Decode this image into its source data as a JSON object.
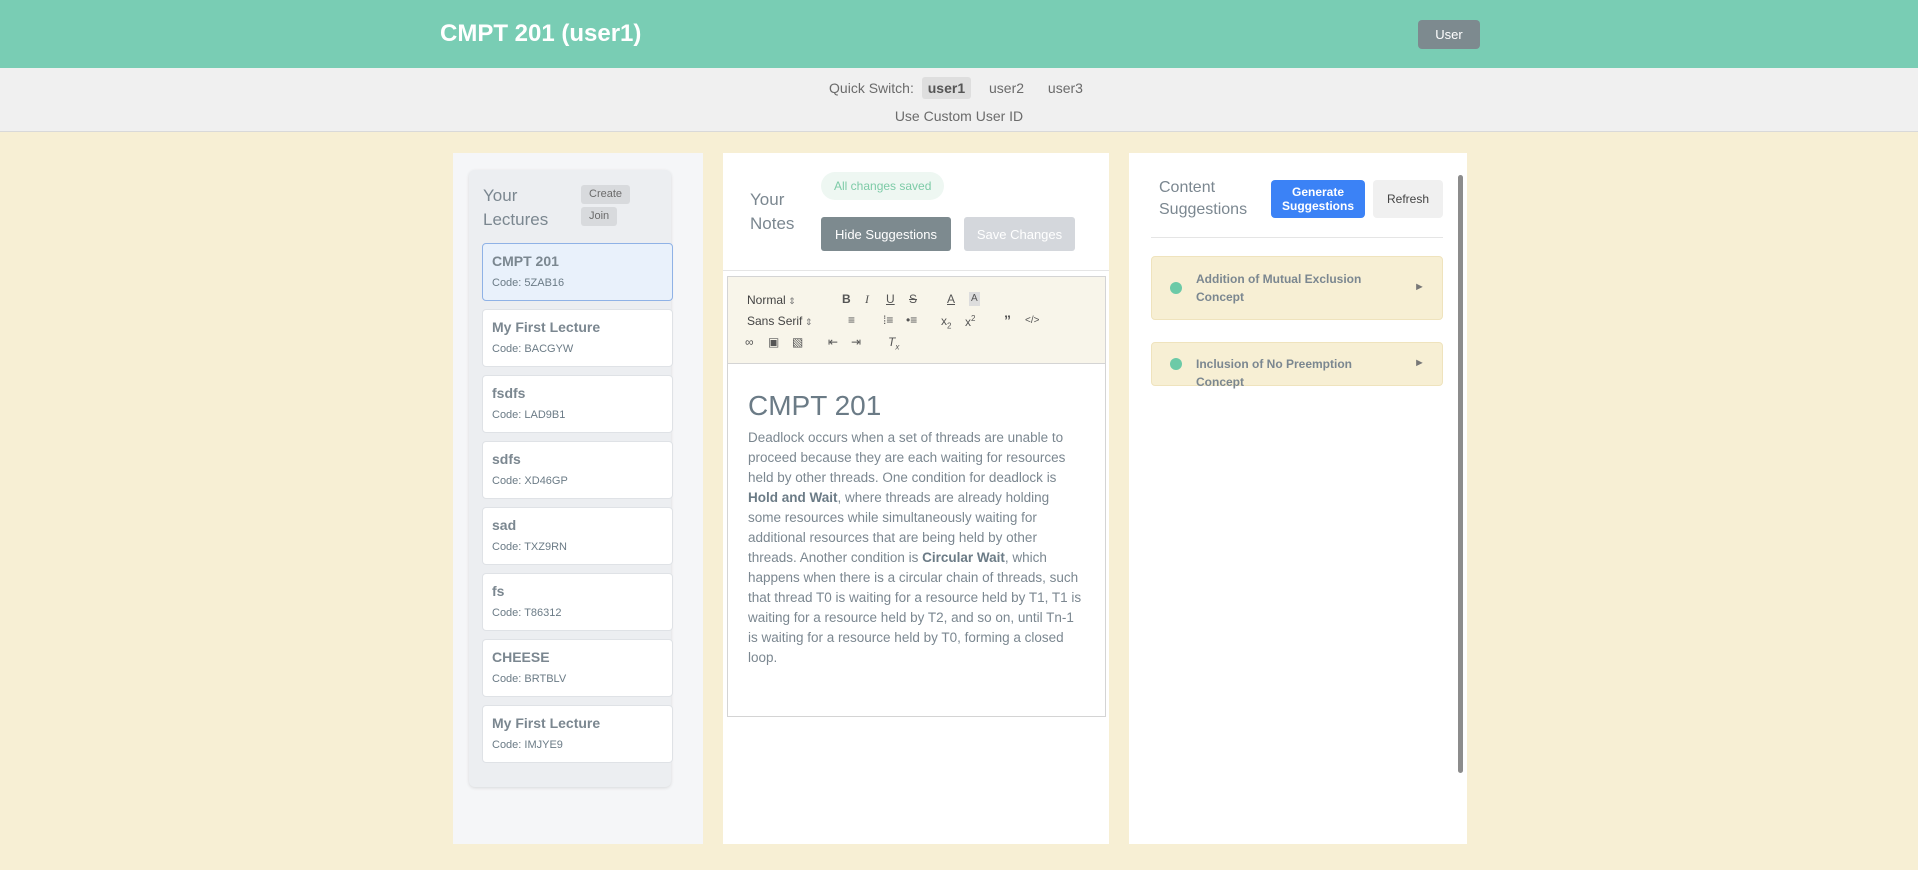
{
  "header": {
    "title": "CMPT 201 (user1)",
    "user_button": "User"
  },
  "quick_switch": {
    "label": "Quick Switch:",
    "users": [
      "user1",
      "user2",
      "user3"
    ],
    "active_user": "user1",
    "custom_id_label": "Use Custom User ID"
  },
  "lectures": {
    "heading": "Your Lectures",
    "create_label": "Create",
    "join_label": "Join",
    "items": [
      {
        "name": "CMPT 201",
        "code": "Code: 5ZAB16",
        "selected": true
      },
      {
        "name": "My First Lecture",
        "code": "Code: BACGYW",
        "selected": false
      },
      {
        "name": "fsdfs",
        "code": "Code: LAD9B1",
        "selected": false
      },
      {
        "name": "sdfs",
        "code": "Code: XD46GP",
        "selected": false
      },
      {
        "name": "sad",
        "code": "Code: TXZ9RN",
        "selected": false
      },
      {
        "name": "fs",
        "code": "Code: T86312",
        "selected": false
      },
      {
        "name": "CHEESE",
        "code": "Code: BRTBLV",
        "selected": false
      },
      {
        "name": "My First Lecture",
        "code": "Code: IMJYE9",
        "selected": false
      }
    ]
  },
  "notes": {
    "heading": "Your Notes",
    "status": "All changes saved",
    "hide_suggestions_label": "Hide Suggestions",
    "save_changes_label": "Save Changes",
    "toolbar": {
      "header_select": "Normal",
      "font_select": "Sans Serif"
    },
    "doc_title": "CMPT 201",
    "paragraph": {
      "p1": "Deadlock occurs when a set of threads are unable to proceed because they are each waiting for resources held by other threads. One condition for deadlock is ",
      "b1": "Hold and Wait",
      "p2": ", where threads are already holding some resources while simultaneously waiting for additional resources that are being held by other threads. Another condition is ",
      "b2": "Circular Wait",
      "p3": ", which happens when there is a circular chain of threads, such that thread T0 is waiting for a resource held by T1, T1 is waiting for a resource held by T2, and so on, until Tn-1 is waiting for a resource held by T0, forming a closed loop."
    }
  },
  "suggestions": {
    "heading": "Content Suggestions",
    "generate_label": "Generate Suggestions",
    "refresh_label": "Refresh",
    "items": [
      {
        "title": "Addition of Mutual Exclusion Concept"
      },
      {
        "title": "Inclusion of No Preemption Concept"
      }
    ]
  },
  "colors": {
    "header_bg": "#79cdb4",
    "page_bg": "#f7efd4",
    "accent_blue": "#3b82f6",
    "dot_green": "#6ccaa7"
  }
}
